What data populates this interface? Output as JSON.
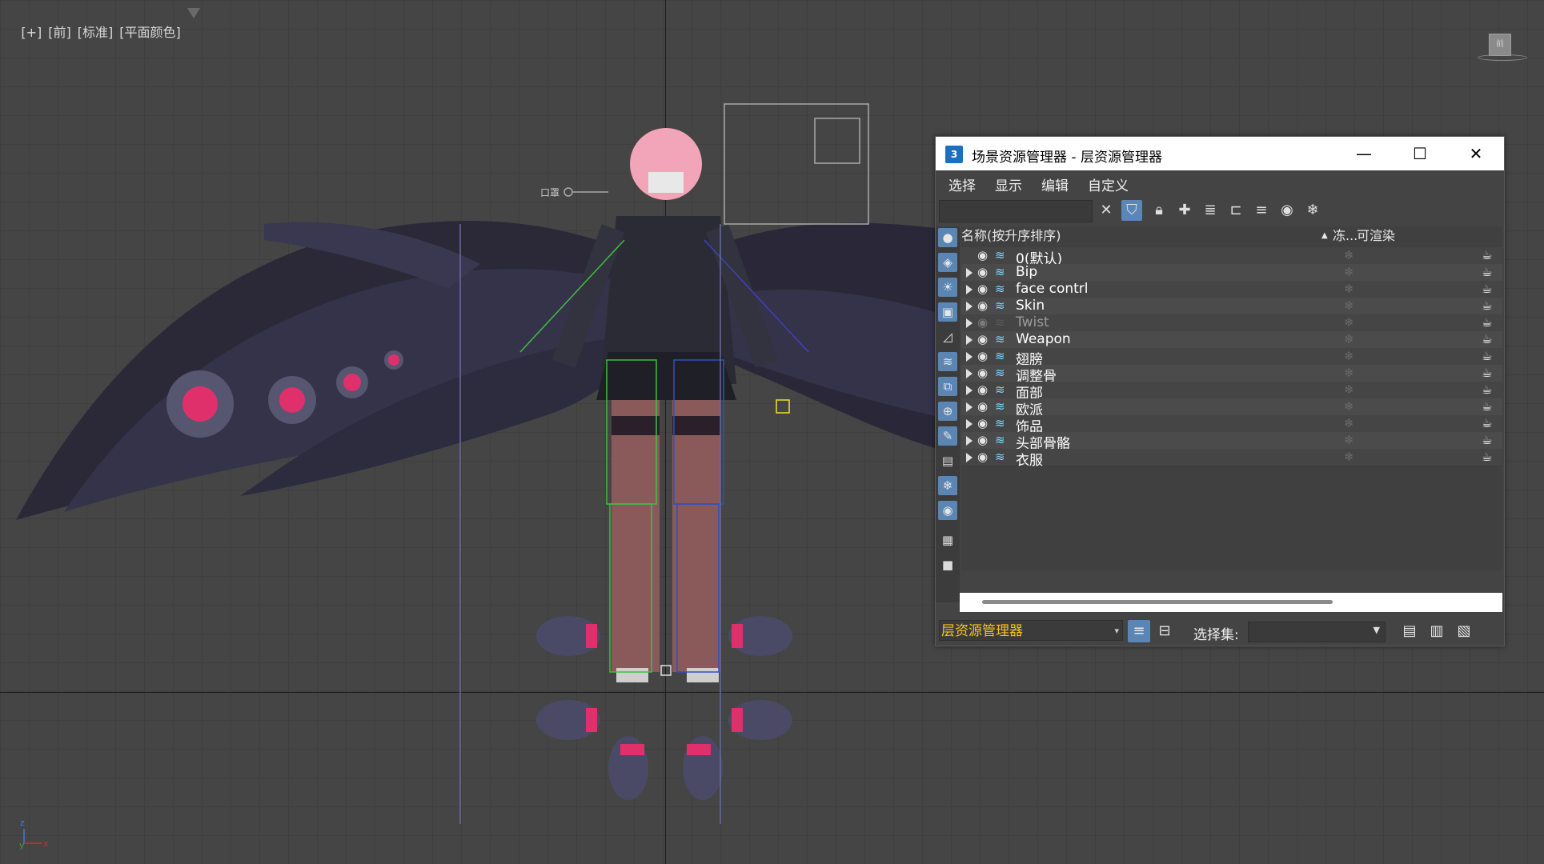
{
  "viewport": {
    "labels": [
      "[+]",
      "[前]",
      "[标准]",
      "[平面颜色]"
    ],
    "viewcube_face": "前",
    "axis_labels": {
      "z": "z",
      "y": "y",
      "x": "x"
    },
    "rig_label": "口罩"
  },
  "explorer": {
    "app_icon": "3",
    "title": "场景资源管理器 - 层资源管理器",
    "window_buttons": {
      "minimize": "—",
      "maximize": "☐",
      "close": "✕"
    },
    "menu": [
      "选择",
      "显示",
      "编辑",
      "自定义"
    ],
    "search": {
      "value": "",
      "placeholder": ""
    },
    "columns": {
      "name": "名称(按升序排序)",
      "sort_indicator": "▲",
      "freeze": "冻...",
      "renderable": "可渲染"
    },
    "layers": [
      {
        "name": "0(默认)",
        "expandable": false,
        "visible": true
      },
      {
        "name": "Bip",
        "expandable": true,
        "visible": true
      },
      {
        "name": "face contrl",
        "expandable": true,
        "visible": true
      },
      {
        "name": "Skin",
        "expandable": true,
        "visible": true
      },
      {
        "name": "Twist",
        "expandable": true,
        "visible": false
      },
      {
        "name": "Weapon",
        "expandable": true,
        "visible": true
      },
      {
        "name": "翅膀",
        "expandable": true,
        "visible": true
      },
      {
        "name": "调整骨",
        "expandable": true,
        "visible": true
      },
      {
        "name": "面部",
        "expandable": true,
        "visible": true
      },
      {
        "name": "欧派",
        "expandable": true,
        "visible": true
      },
      {
        "name": "饰品",
        "expandable": true,
        "visible": true
      },
      {
        "name": "头部骨骼",
        "expandable": true,
        "visible": true
      },
      {
        "name": "衣服",
        "expandable": true,
        "visible": true
      }
    ],
    "bottom": {
      "explorer_type": "层资源管理器",
      "selection_set_label": "选择集:",
      "selection_set_value": ""
    },
    "colors": {
      "accent": "#5b86b3",
      "combo_text": "#f5c518"
    }
  }
}
